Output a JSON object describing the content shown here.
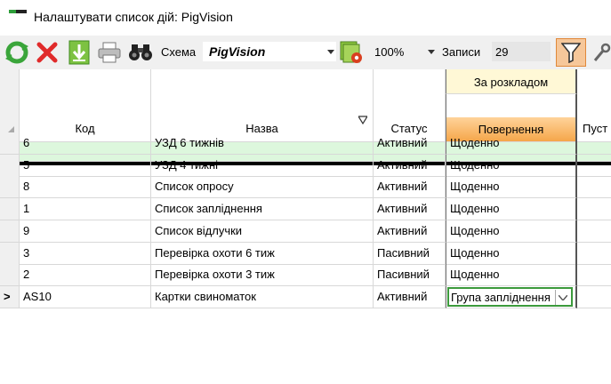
{
  "window": {
    "title": "Налаштувати список дій: PigVision"
  },
  "toolbar": {
    "refresh_icon": "refresh-icon",
    "delete_icon": "delete-icon",
    "import_icon": "download-icon",
    "print_icon": "printer-icon",
    "find_icon": "binoculars-icon",
    "schema_label": "Схема",
    "schema_value": "PigVision",
    "zoom_value": "100%",
    "records_label": "Записи",
    "records_value": "29",
    "accent_color": "#f6c79a"
  },
  "grid": {
    "group_header": "За розкладом",
    "columns": [
      "Код",
      "Назва",
      "Статус",
      "Повернення",
      "Пуст"
    ],
    "rows": [
      {
        "code": "6",
        "name": "УЗД 6 тижнів",
        "status": "Активний",
        "repeat": "Щоденно"
      },
      {
        "code": "5",
        "name": "УЗД 4 тижні",
        "status": "Активний",
        "repeat": "Щоденно"
      },
      {
        "code": "8",
        "name": "Список опросу",
        "status": "Активний",
        "repeat": "Щоденно"
      },
      {
        "code": "1",
        "name": "Список запліднення",
        "status": "Активний",
        "repeat": "Щоденно"
      },
      {
        "code": "9",
        "name": "Список відлучки",
        "status": "Активний",
        "repeat": "Щоденно"
      },
      {
        "code": "3",
        "name": "Перевірка охоти 6 тиж",
        "status": "Пасивний",
        "repeat": "Щоденно"
      },
      {
        "code": "2",
        "name": "Перевірка охоти 3 тиж",
        "status": "Пасивний",
        "repeat": "Щоденно"
      },
      {
        "code": "AS10",
        "name": "Картки свиноматок",
        "status": "Активний",
        "repeat": "Група запліднення"
      }
    ],
    "current_row_marker": ">"
  }
}
